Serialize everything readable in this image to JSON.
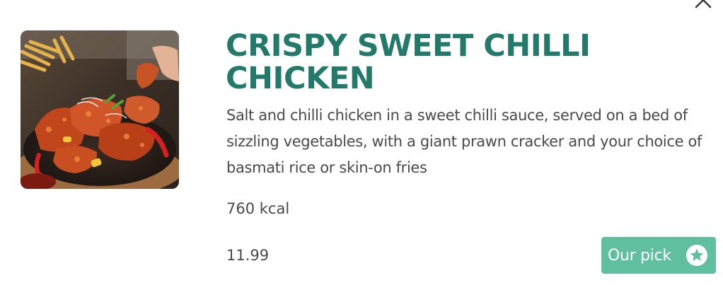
{
  "item": {
    "title": "CRISPY SWEET CHILLI CHICKEN",
    "description": "Salt and chilli chicken in a sweet chilli sauce, served on a bed of sizzling vegetables, with a giant prawn cracker and your choice of basmati rice or skin-on fries",
    "calories": "760 kcal",
    "price": "11.99",
    "badge_label": "Our pick",
    "badge_icon": "star-icon"
  },
  "icons": {
    "close": "close-icon"
  },
  "colors": {
    "title": "#237a6b",
    "body_text": "#4a4a4a",
    "badge_bg": "#5fbf9e",
    "badge_text": "#ffffff"
  }
}
